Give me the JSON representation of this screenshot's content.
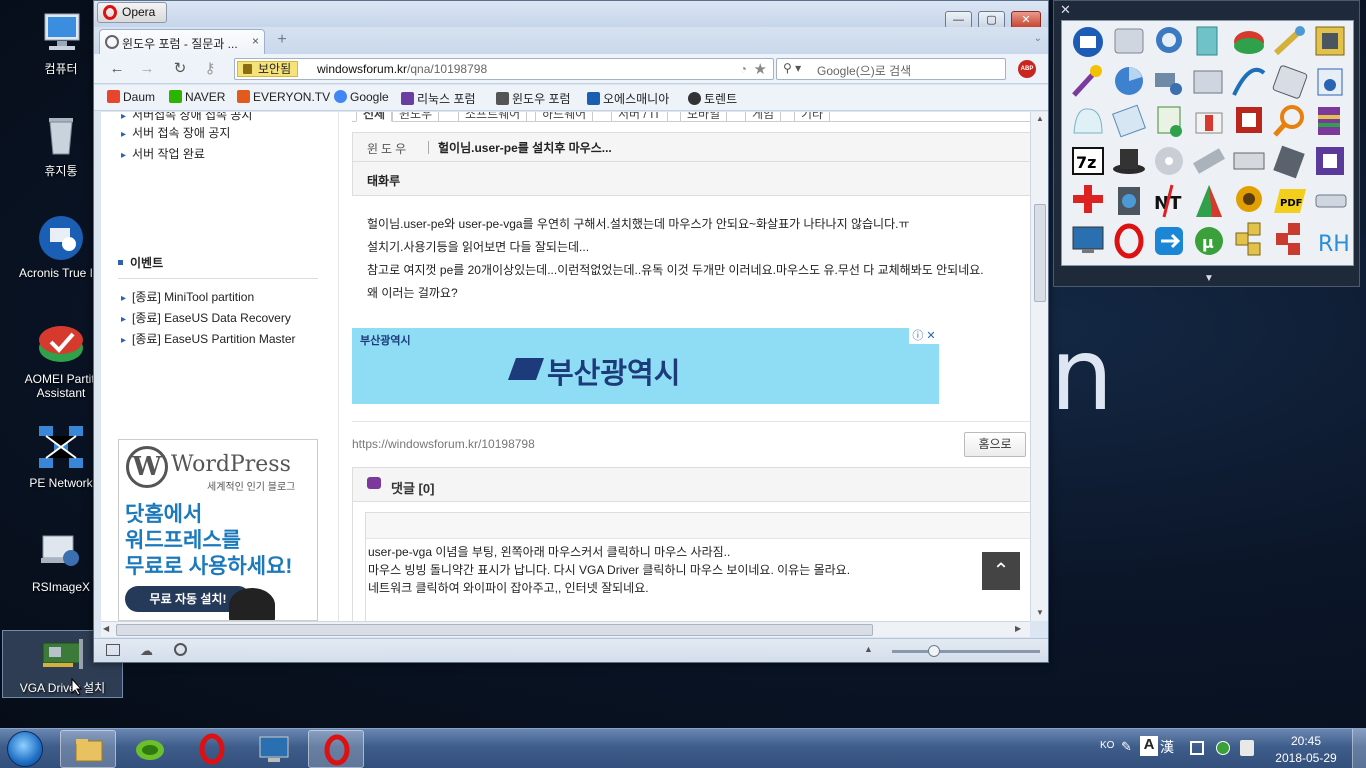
{
  "desktop": {
    "icons": [
      {
        "label": "컴퓨터"
      },
      {
        "label": "휴지통"
      },
      {
        "label": "Acronis True Im"
      },
      {
        "label": "AOMEI Partiti Assistant"
      },
      {
        "label": "PE Network"
      },
      {
        "label": "RSImageX"
      },
      {
        "label": "VGA Driver 설치"
      }
    ],
    "wallpaper_letter": "n"
  },
  "browser": {
    "app_title": "Opera",
    "tab_title": "윈도우 포럼 - 질문과 ...",
    "tab_close": "×",
    "new_tab": "+",
    "address": {
      "security_label": "보안됨",
      "url_host": "windowsforum.kr",
      "url_path": "/qna/10198798"
    },
    "search_placeholder": "Google(으)로 검색",
    "abp_label": "ABP",
    "bookmarks": [
      {
        "label": "Daum",
        "color": "#e8452c"
      },
      {
        "label": "NAVER",
        "color": "#2db400"
      },
      {
        "label": "EVERYON.TV",
        "color": "#e25a1c"
      },
      {
        "label": "Google",
        "color": "#4285f4"
      },
      {
        "label": "리눅스 포럼",
        "color": "#6b3fa0"
      },
      {
        "label": "윈도우 포럼",
        "color": "#555555"
      },
      {
        "label": "오에스매니아",
        "color": "#1b5fb3"
      },
      {
        "label": "토렌트",
        "color": "#333333"
      }
    ]
  },
  "page": {
    "sidebar": {
      "top_links": [
        "서버 접속 장애 공지",
        "서버 작업 완료"
      ],
      "partial_link": "서버접속 장애 접속 공지",
      "events_heading": "이벤트",
      "events": [
        "[종료] MiniTool partition",
        "[종료] EaseUS Data Recovery",
        "[종료] EaseUS Partition Master"
      ],
      "ad": {
        "brand": "WordPress",
        "sub": "세계적인 인기 블로그",
        "line1": "닷홈에서",
        "line2": "워드프레스를",
        "line3": "무료로 사용하세요!",
        "cta": "무료 자동 설치!"
      }
    },
    "tabstrip": [
      "전체",
      "윈도우",
      "소프트웨어",
      "하드웨어",
      "서버 / IT",
      "모바일",
      "게임",
      "기타"
    ],
    "post": {
      "category": "윈도우",
      "title": "헐이님.user-pe를 설치후 마우스...",
      "author": "태화루",
      "body": [
        "헐이님.user-pe와 user-pe-vga를 우연히 구해서.설치했는데 마우스가 안되요~화살표가 나타나지 않습니다.ㅠ",
        "설치기.사용기등을 읽어보면 다들 잘되는데...",
        "참고로 여지껏 pe를 20개이상있는데...이런적없었는데..유독 이것 두개만 이러네요.마우스도 유.무선 다 교체해봐도 안되네요.",
        "왜 이러는 걸까요?"
      ],
      "ad_small": "부산광역시",
      "ad_big": "부산광역시",
      "ad_choice": "ⓘ ✕",
      "short_url": "https://windowsforum.kr/10198798",
      "home_button": "홈으로"
    },
    "comments": {
      "title": "댓글 [0]",
      "lines": [
        "user-pe-vga 이념을 부팅, 왼쪽아래 마우스커서 클릭하니 마우스 사라짐..",
        "마우스 빙빙 돌니약간 표시가 납니다. 다시 VGA Driver 클릭하니  마우스 보이네요. 이유는  몰라요.",
        "네트워크 클릭하여  와이파이 잡아주고,, 인터넷 잘되네요."
      ]
    },
    "to_top": "⌃"
  },
  "taskbar": {
    "language": "KO",
    "ime_a": "A",
    "ime_han": "漢",
    "time": "20:45",
    "date": "2018-05-29"
  }
}
